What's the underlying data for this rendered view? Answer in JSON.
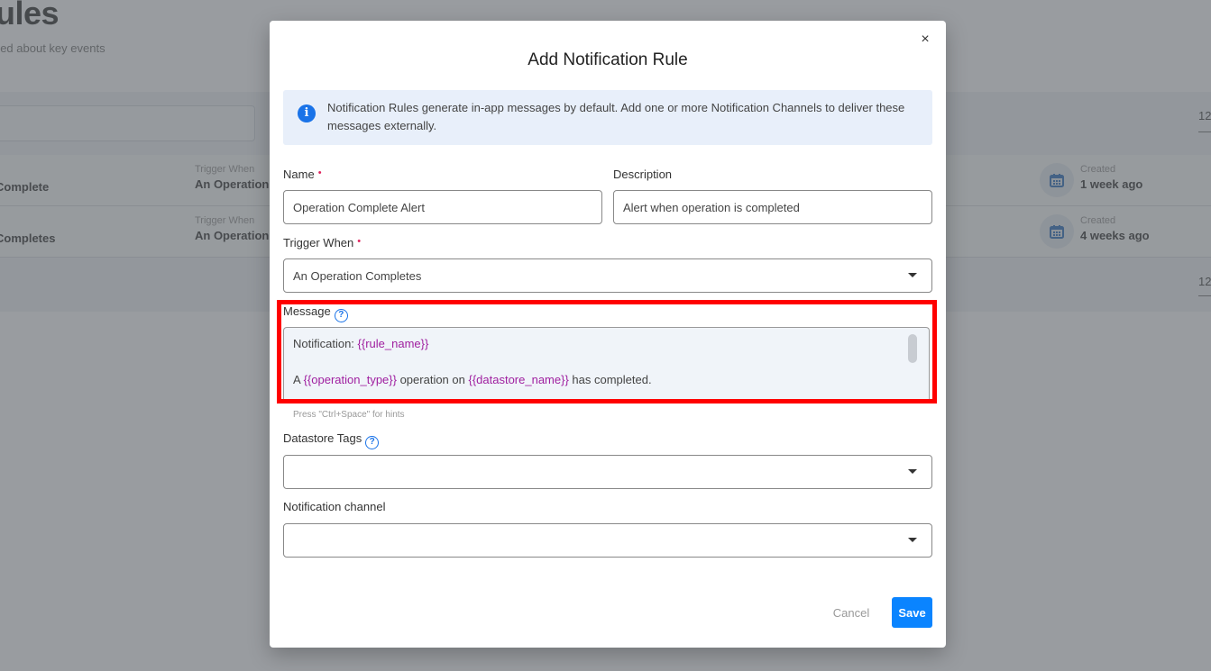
{
  "background": {
    "page_title": "Notification Rules",
    "page_subtitle": "Create notification rules to stay informed about key events",
    "pagination_top": "12",
    "pagination_bottom": "12",
    "rows": [
      {
        "name": "Operation Complete",
        "trigger_label": "Trigger When",
        "trigger_value": "An Operation Completes",
        "created_label": "Created",
        "created_value": "1 week ago"
      },
      {
        "name": "Operation Completes",
        "trigger_label": "Trigger When",
        "trigger_value": "An Operation Completes",
        "created_label": "Created",
        "created_value": "4 weeks ago"
      }
    ]
  },
  "modal": {
    "title": "Add Notification Rule",
    "close_icon": "×",
    "info_icon": "i",
    "info_text": "Notification Rules generate in-app messages by default. Add one or more Notification Channels to deliver these messages externally.",
    "required_marker": "•",
    "name": {
      "label": "Name",
      "value": "Operation Complete Alert"
    },
    "description": {
      "label": "Description",
      "value": "Alert when operation is completed"
    },
    "trigger": {
      "label": "Trigger When",
      "value": "An Operation Completes"
    },
    "message": {
      "label": "Message",
      "help_icon": "?",
      "line1_prefix": "Notification: ",
      "line1_var": "{{rule_name}}",
      "line2_a": "A ",
      "line2_var1": "{{operation_type}}",
      "line2_b": " operation on ",
      "line2_var2": "{{datastore_name}}",
      "line2_c": " has completed.",
      "hint": "Press \"Ctrl+Space\" for hints"
    },
    "datastore_tags": {
      "label": "Datastore Tags",
      "help_icon": "?",
      "value": ""
    },
    "notification_channel": {
      "label": "Notification channel",
      "value": ""
    },
    "cancel_label": "Cancel",
    "save_label": "Save"
  },
  "colors": {
    "primary": "#0a84ff",
    "variable": "#a020a0",
    "required": "#e0245e",
    "highlight": "#ff0000"
  }
}
